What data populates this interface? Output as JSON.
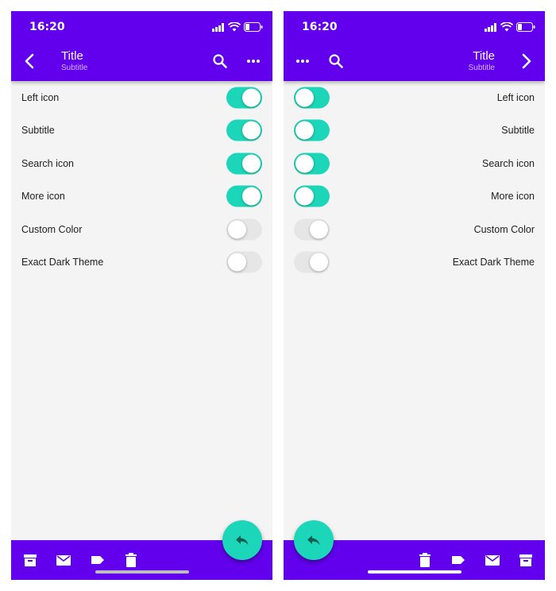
{
  "colors": {
    "primary": "#6200ee",
    "accent": "#1bd6b8",
    "background": "#f4f4f4"
  },
  "left": {
    "status": {
      "time": "16:20"
    },
    "appbar": {
      "title": "Title",
      "subtitle": "Subtitle",
      "nav_icon": "back-chevron-icon",
      "actions": [
        "search-icon",
        "more-icon"
      ]
    },
    "settings": [
      {
        "label": "Left icon",
        "on": true
      },
      {
        "label": "Subtitle",
        "on": true
      },
      {
        "label": "Search icon",
        "on": true
      },
      {
        "label": "More icon",
        "on": true
      },
      {
        "label": "Custom Color",
        "on": false
      },
      {
        "label": "Exact Dark Theme",
        "on": false
      }
    ],
    "bottom_actions": [
      "archive-icon",
      "mail-icon",
      "label-icon",
      "delete-icon"
    ],
    "fab_icon": "reply-icon"
  },
  "right": {
    "status": {
      "time": "16:20"
    },
    "appbar": {
      "title": "Title",
      "subtitle": "Subtitle",
      "nav_icon": "forward-chevron-icon",
      "actions": [
        "more-icon",
        "search-icon"
      ]
    },
    "settings": [
      {
        "label": "Left icon",
        "on": true
      },
      {
        "label": "Subtitle",
        "on": true
      },
      {
        "label": "Search icon",
        "on": true
      },
      {
        "label": "More icon",
        "on": true
      },
      {
        "label": "Custom Color",
        "on": false
      },
      {
        "label": "Exact Dark Theme",
        "on": false
      }
    ],
    "bottom_actions": [
      "delete-icon",
      "label-icon",
      "mail-icon",
      "archive-icon"
    ],
    "fab_icon": "reply-icon"
  }
}
